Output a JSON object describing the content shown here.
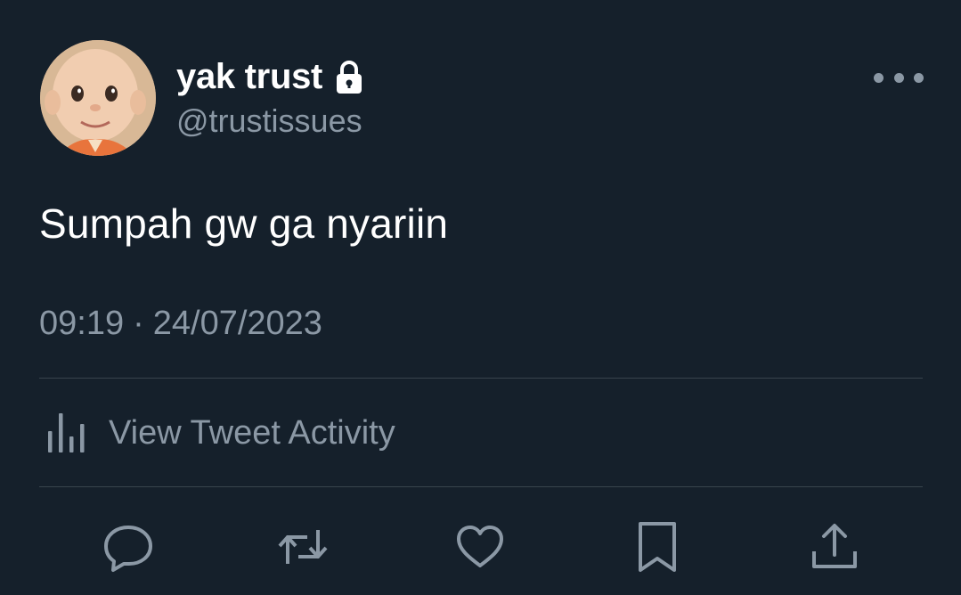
{
  "author": {
    "display_name": "yak trust",
    "handle": "@trustissues",
    "protected_icon": "lock-icon",
    "avatar": "profile-avatar"
  },
  "tweet": {
    "text": "Sumpah gw ga nyariin",
    "time": "09:19",
    "separator": "·",
    "date": "24/07/2023"
  },
  "activity": {
    "label": "View Tweet Activity",
    "icon": "bar-chart-icon"
  },
  "actions": [
    {
      "icon": "reply-icon"
    },
    {
      "icon": "retweet-icon"
    },
    {
      "icon": "like-icon"
    },
    {
      "icon": "bookmark-icon"
    },
    {
      "icon": "share-icon"
    }
  ],
  "colors": {
    "background": "#15202b",
    "primary_text": "#ffffff",
    "secondary_text": "#8b98a5",
    "divider": "#38444d"
  }
}
